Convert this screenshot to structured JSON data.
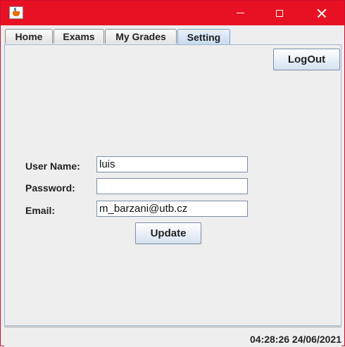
{
  "window": {
    "title": "",
    "colors": {
      "titlebar": "#e81123",
      "accent_tab": "#c9daf0"
    },
    "controls": {
      "minimize_icon": "minimize-icon",
      "maximize_icon": "maximize-icon",
      "close_icon": "close-icon"
    }
  },
  "tabs": [
    {
      "label": "Home",
      "active": false
    },
    {
      "label": "Exams",
      "active": false
    },
    {
      "label": "My Grades",
      "active": false
    },
    {
      "label": "Setting",
      "active": true
    }
  ],
  "toolbar": {
    "logout_label": "LogOut"
  },
  "form": {
    "username_label": "User Name:",
    "username_value": "luis",
    "password_label": "Password:",
    "password_value": "",
    "email_label": "Email:",
    "email_value": "m_barzani@utb.cz",
    "update_label": "Update"
  },
  "status": {
    "clock": "04:28:26 24/06/2021"
  }
}
